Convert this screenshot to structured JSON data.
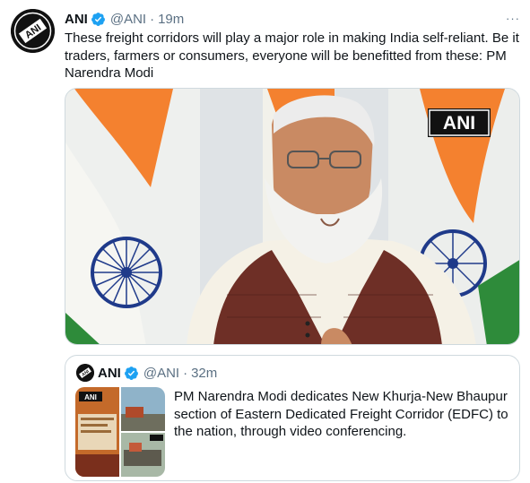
{
  "tweet": {
    "author_name": "ANI",
    "handle": "@ANI",
    "separator": "·",
    "time": "19m",
    "more_icon": "···",
    "text": "These freight corridors will play a major role in making India self-reliant. Be it traders, farmers or consumers, everyone will be benefitted from these: PM Narendra Modi",
    "media": {
      "watermark": "ANI",
      "icon": "video-still-image"
    }
  },
  "quoted_tweet": {
    "author_name": "ANI",
    "handle": "@ANI",
    "separator": "·",
    "time": "32m",
    "text": "PM Narendra Modi dedicates New Khurja-New Bhaupur section of Eastern Dedicated Freight Corridor (EDFC) to the nation, through video conferencing.",
    "thumbnail_badge": "ANI"
  },
  "colors": {
    "verified_blue": "#1da1f2",
    "secondary_text": "#5b7083",
    "saffron": "#f4812f",
    "india_green": "#2e8b3a",
    "chakra_blue": "#1f3a8a"
  }
}
